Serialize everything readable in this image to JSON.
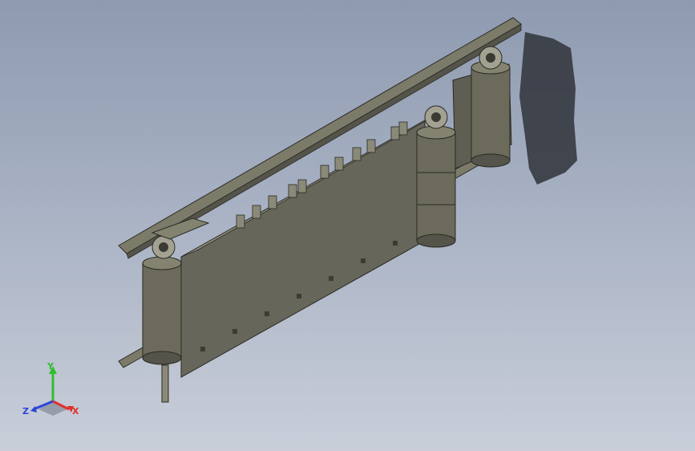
{
  "viewport": {
    "background_top": "#8e9ab0",
    "background_bottom": "#c9ced9",
    "model_color": "#6f6e5e",
    "shadow_color": "#2e3038"
  },
  "triad": {
    "x_label": "X",
    "y_label": "Y",
    "z_label": "Z",
    "x_color": "#e0312b",
    "y_color": "#2fbf2f",
    "z_color": "#2b45d8"
  }
}
